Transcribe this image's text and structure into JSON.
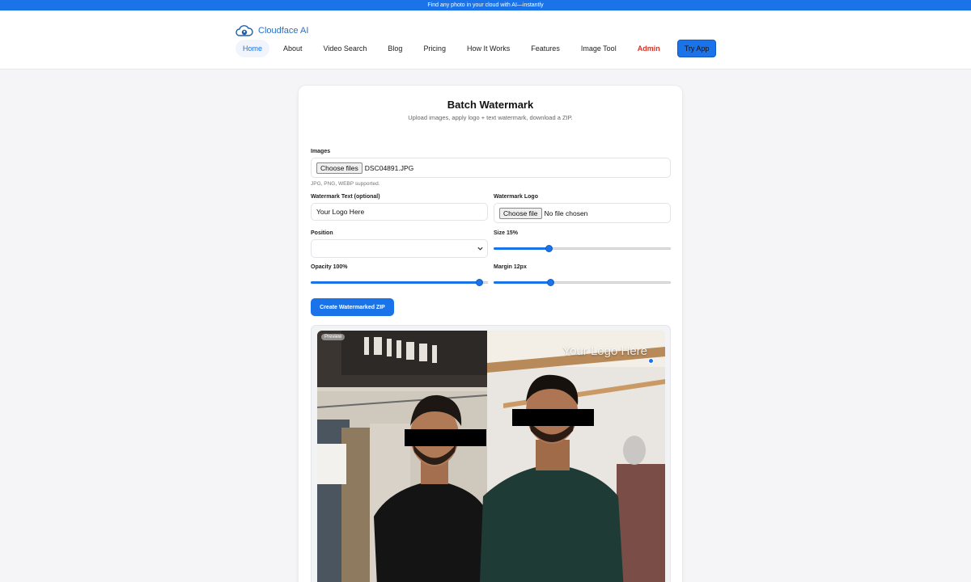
{
  "topbar": {
    "text": "Find any photo in your cloud with AI—instantly"
  },
  "brand": {
    "name": "Cloudface AI",
    "logo_icon": "cloud-logo-icon"
  },
  "nav": {
    "items": [
      {
        "label": "Home",
        "active": true
      },
      {
        "label": "About"
      },
      {
        "label": "Video Search"
      },
      {
        "label": "Blog"
      },
      {
        "label": "Pricing"
      },
      {
        "label": "How It Works"
      },
      {
        "label": "Features"
      },
      {
        "label": "Image Tool"
      },
      {
        "label": "Admin",
        "highlight": "#d93025"
      }
    ],
    "cta": "Try App"
  },
  "card": {
    "title": "Batch Watermark",
    "subtitle": "Upload images, apply logo + text watermark, download a ZIP."
  },
  "form": {
    "images": {
      "label": "Images",
      "button": "Choose files",
      "value": "DSC04891.JPG",
      "hint": "JPG, PNG, WEBP supported."
    },
    "watermark_text": {
      "label": "Watermark Text (optional)",
      "value": "Your Logo Here"
    },
    "watermark_logo": {
      "label": "Watermark Logo",
      "button": "Choose file",
      "value": "No file chosen"
    },
    "position": {
      "label": "Position",
      "value": ""
    },
    "size": {
      "label": "Size 15%",
      "value": 0.31
    },
    "opacity": {
      "label": "Opacity 100%",
      "value": 0.95
    },
    "margin": {
      "label": "Margin 12px",
      "value": 0.32
    },
    "submit": "Create Watermarked ZIP"
  },
  "preview": {
    "badge": "Preview",
    "watermark": "Your Logo Here"
  },
  "colors": {
    "accent": "#1a73e8",
    "admin": "#d93025",
    "brand": "#2b6fc2"
  }
}
